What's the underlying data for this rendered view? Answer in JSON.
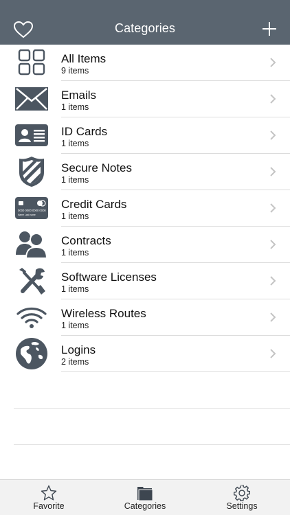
{
  "header": {
    "title": "Categories",
    "left_icon": "heart-outline-icon",
    "right_icon": "plus-icon",
    "background": "#5a6570"
  },
  "categories": [
    {
      "label": "All Items",
      "count": "9 items",
      "icon": "grid-icon"
    },
    {
      "label": "Emails",
      "count": "1 items",
      "icon": "envelope-icon"
    },
    {
      "label": "ID Cards",
      "count": "1 items",
      "icon": "id-card-icon"
    },
    {
      "label": "Secure Notes",
      "count": "1 items",
      "icon": "shield-icon"
    },
    {
      "label": "Credit Cards",
      "count": "1 items",
      "icon": "credit-card-icon"
    },
    {
      "label": "Contracts",
      "count": "1 items",
      "icon": "people-icon"
    },
    {
      "label": "Software Licenses",
      "count": "1 items",
      "icon": "tools-icon"
    },
    {
      "label": "Wireless Routes",
      "count": "1 items",
      "icon": "wifi-icon"
    },
    {
      "label": "Logins",
      "count": "2 items",
      "icon": "globe-icon"
    }
  ],
  "card_text": {
    "number": "0000 0000 0000 0000",
    "name": "Name Last name"
  },
  "tabbar": {
    "tabs": [
      {
        "label": "Favorite",
        "icon": "star-icon"
      },
      {
        "label": "Categories",
        "icon": "folder-icon"
      },
      {
        "label": "Settings",
        "icon": "gear-icon"
      }
    ]
  },
  "colors": {
    "icon": "#4c5661",
    "separator": "#dcdcdc",
    "tabbar": "#f2f2f2"
  }
}
